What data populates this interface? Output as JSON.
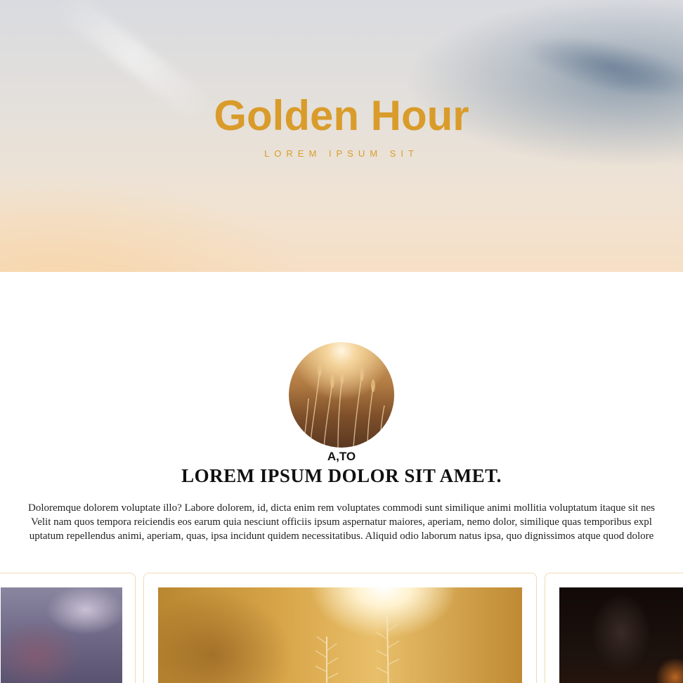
{
  "hero": {
    "title": "Golden Hour",
    "subtitle": "LOREM IPSUM SIT"
  },
  "about": {
    "name": "A,TO",
    "heading": "LOREM IPSUM DOLOR SIT AMET.",
    "paragraph_lines": [
      "Doloremque dolorem voluptate illo? Labore dolorem, id, dicta enim rem voluptates commodi sunt similique animi mollitia voluptatum itaque sit nes",
      "Velit nam quos tempora reiciendis eos earum quia nesciunt officiis ipsum aspernatur maiores, aperiam, nemo dolor, similique quas temporibus expl",
      "uptatum repellendus animi, aperiam, quas, ipsa incidunt quidem necessitatibus. Aliquid odio laborum natus ipsa, quo dignissimos atque quod dolore"
    ]
  },
  "gallery": {
    "cards": [
      {
        "image": "stormy-clouds-photo"
      },
      {
        "image": "golden-grass-sunlight-photo"
      },
      {
        "image": "dark-forest-photo"
      }
    ]
  },
  "colors": {
    "accent": "#d99c2b",
    "card_border": "#e0b46a",
    "text": "#111111"
  }
}
